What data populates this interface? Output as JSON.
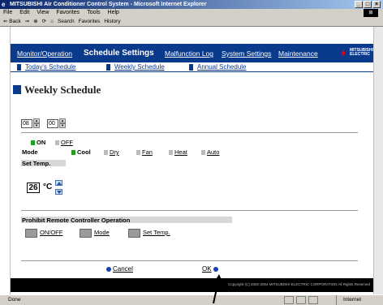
{
  "window": {
    "title": "MITSUBISHI Air Conditioner Control System - Microsoft Internet Explorer",
    "controls": [
      "_",
      "□",
      "×"
    ]
  },
  "menubar": {
    "items": [
      "File",
      "Edit",
      "View",
      "Favorites",
      "Tools",
      "Help"
    ]
  },
  "toolbar": {
    "items": [
      "⇐ Back",
      "⇒",
      "⊗",
      "⟳",
      "⌂",
      "Search",
      "Favorites",
      "History"
    ]
  },
  "nav": {
    "items": [
      "Monitor/Operation",
      "Schedule Settings",
      "Malfunction Log",
      "System Settings",
      "Maintenance"
    ],
    "active": "Schedule Settings",
    "logo_text": "MITSUBISHI ELECTRIC"
  },
  "subnav": {
    "items": [
      "Today's Schedule",
      "Weekly Schedule",
      "Annual Schedule"
    ]
  },
  "page": {
    "title": "Weekly Schedule"
  },
  "time": {
    "hour": "08",
    "minute": "00"
  },
  "power": {
    "on": "ON",
    "off": "OFF",
    "selected": "ON"
  },
  "mode": {
    "label": "Mode",
    "options": [
      "Cool",
      "Dry",
      "Fan",
      "Heat",
      "Auto"
    ],
    "selected": "Cool"
  },
  "set_temp": {
    "label": "Set Temp.",
    "value": "26",
    "unit": "°C"
  },
  "prohibit": {
    "label": "Prohibit Remote Controller Operation",
    "options": [
      "ON/OFF",
      "Mode",
      "Set Temp."
    ]
  },
  "actions": {
    "cancel": "Cancel",
    "ok": "OK"
  },
  "footer": {
    "copyright": "Copyright (C) 2002-2004 MITSUBISHI ELECTRIC CORPORATION All Rights Reserved"
  },
  "statusbar": {
    "status": "Done",
    "zone": "Internet"
  },
  "colors": {
    "nav_bg": "#0a3a8c",
    "on_green": "#1fa01f",
    "footer_bg": "#000000"
  }
}
